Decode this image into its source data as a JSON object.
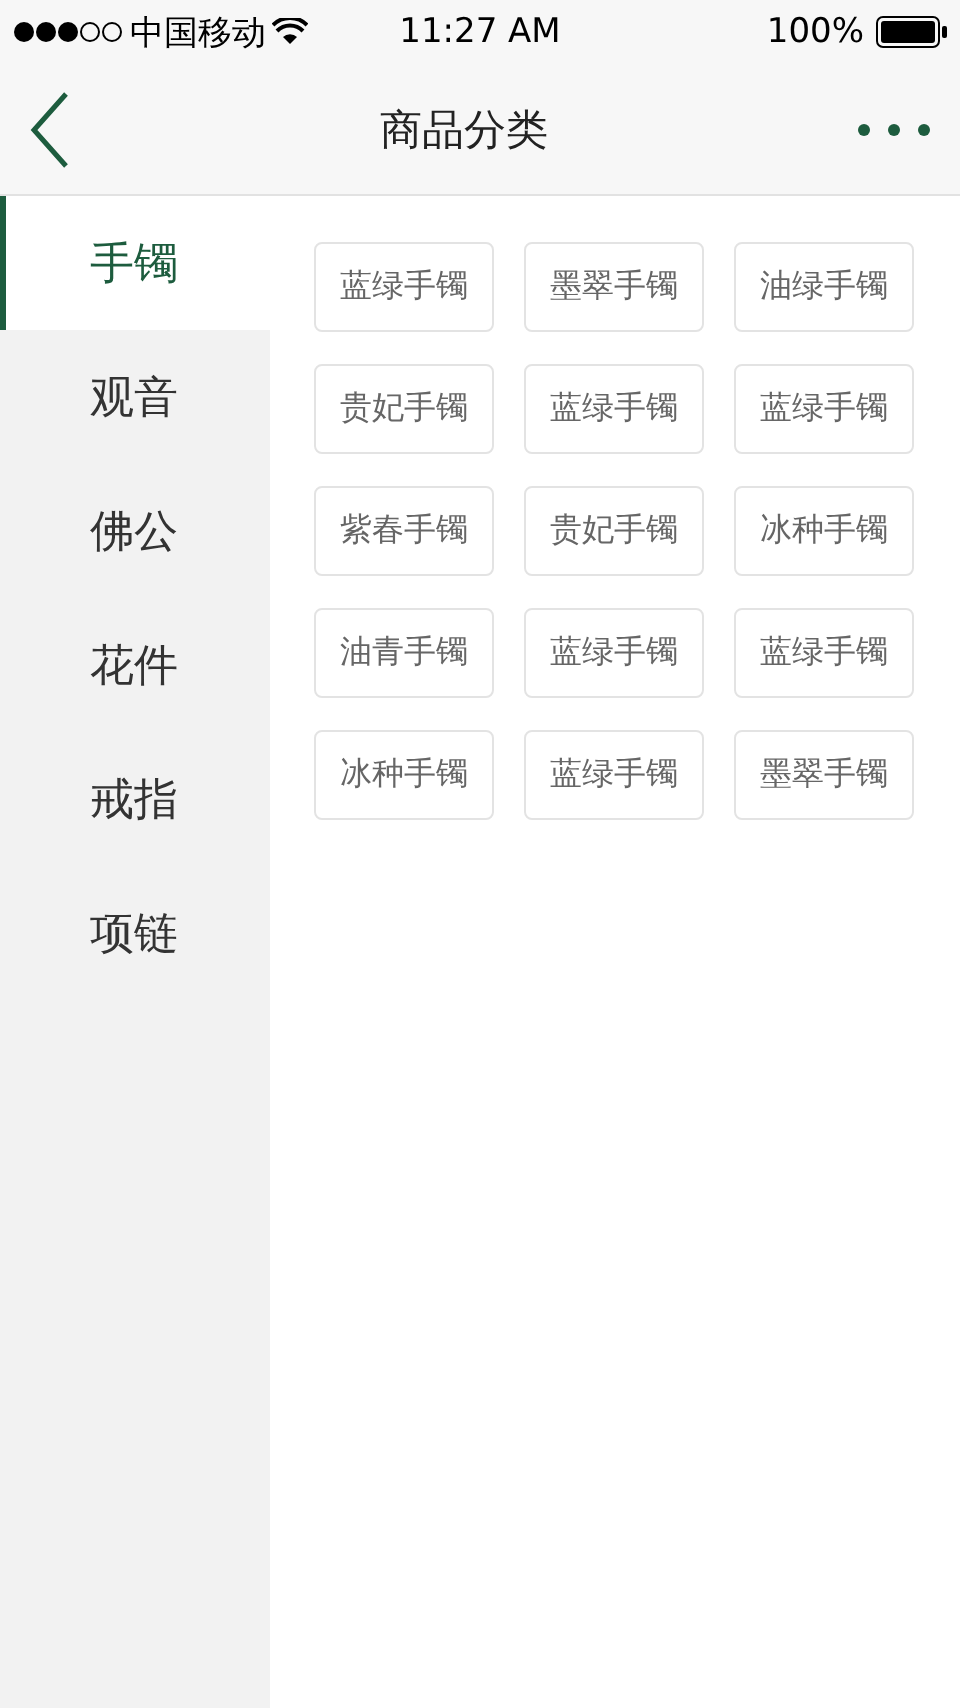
{
  "status_bar": {
    "carrier": "中国移动",
    "time": "11:27 AM",
    "battery": "100%"
  },
  "nav": {
    "title": "商品分类"
  },
  "categories": [
    {
      "label": "手镯",
      "selected": true
    },
    {
      "label": "观音",
      "selected": false
    },
    {
      "label": "佛公",
      "selected": false
    },
    {
      "label": "花件",
      "selected": false
    },
    {
      "label": "戒指",
      "selected": false
    },
    {
      "label": "项链",
      "selected": false
    }
  ],
  "tags": [
    "蓝绿手镯",
    "墨翠手镯",
    "油绿手镯",
    "贵妃手镯",
    "蓝绿手镯",
    "蓝绿手镯",
    "紫春手镯",
    "贵妃手镯",
    "冰种手镯",
    "油青手镯",
    "蓝绿手镯",
    "蓝绿手镯",
    "冰种手镯",
    "蓝绿手镯",
    "墨翠手镯"
  ]
}
